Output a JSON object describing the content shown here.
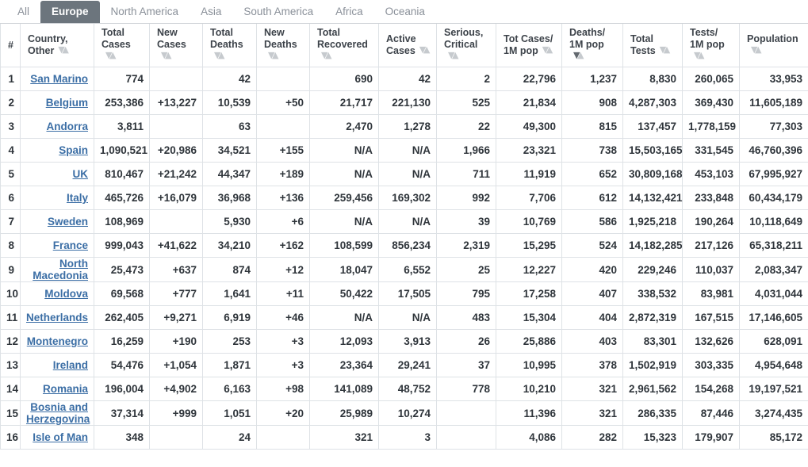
{
  "tabs": [
    {
      "label": "All",
      "active": false
    },
    {
      "label": "Europe",
      "active": true
    },
    {
      "label": "North America",
      "active": false
    },
    {
      "label": "Asia",
      "active": false
    },
    {
      "label": "South America",
      "active": false
    },
    {
      "label": "Africa",
      "active": false
    },
    {
      "label": "Oceania",
      "active": false
    }
  ],
  "colors": {
    "active_tab_bg": "#6c757d",
    "new_cases_highlight": "#fae5a0",
    "new_deaths_highlight": "#ff0000",
    "link": "#3b6ea5"
  },
  "table": {
    "columns": [
      {
        "key": "num",
        "line1": "#",
        "line2": "",
        "sortable": false,
        "sorted": false
      },
      {
        "key": "country",
        "line1": "Country,",
        "line2": "Other",
        "sortable": true,
        "sorted": false
      },
      {
        "key": "total_cases",
        "line1": "Total",
        "line2": "Cases",
        "sortable": true,
        "sorted": false
      },
      {
        "key": "new_cases",
        "line1": "New",
        "line2": "Cases",
        "sortable": true,
        "sorted": false
      },
      {
        "key": "total_deaths",
        "line1": "Total",
        "line2": "Deaths",
        "sortable": true,
        "sorted": false
      },
      {
        "key": "new_deaths",
        "line1": "New",
        "line2": "Deaths",
        "sortable": true,
        "sorted": false
      },
      {
        "key": "total_recovered",
        "line1": "Total",
        "line2": "Recovered",
        "sortable": true,
        "sorted": false
      },
      {
        "key": "active_cases",
        "line1": "Active",
        "line2": "Cases",
        "sortable": true,
        "sorted": false
      },
      {
        "key": "serious",
        "line1": "Serious,",
        "line2": "Critical",
        "sortable": true,
        "sorted": false
      },
      {
        "key": "cases_1m",
        "line1": "Tot Cases/",
        "line2": "1M pop",
        "sortable": true,
        "sorted": false
      },
      {
        "key": "deaths_1m",
        "line1": "Deaths/",
        "line2": "1M pop",
        "sortable": true,
        "sorted": true
      },
      {
        "key": "total_tests",
        "line1": "Total",
        "line2": "Tests",
        "sortable": true,
        "sorted": false
      },
      {
        "key": "tests_1m",
        "line1": "Tests/",
        "line2": "1M pop",
        "sortable": true,
        "sorted": false
      },
      {
        "key": "population",
        "line1": "Population",
        "line2": "",
        "sortable": true,
        "sorted": false
      }
    ],
    "rows": [
      {
        "num": "1",
        "country": "San Marino",
        "total_cases": "774",
        "new_cases": "",
        "total_deaths": "42",
        "new_deaths": "",
        "total_recovered": "690",
        "active_cases": "42",
        "serious": "2",
        "cases_1m": "22,796",
        "deaths_1m": "1,237",
        "total_tests": "8,830",
        "tests_1m": "260,065",
        "population": "33,953",
        "tall": false
      },
      {
        "num": "2",
        "country": "Belgium",
        "total_cases": "253,386",
        "new_cases": "+13,227",
        "total_deaths": "10,539",
        "new_deaths": "+50",
        "total_recovered": "21,717",
        "active_cases": "221,130",
        "serious": "525",
        "cases_1m": "21,834",
        "deaths_1m": "908",
        "total_tests": "4,287,303",
        "tests_1m": "369,430",
        "population": "11,605,189",
        "tall": false
      },
      {
        "num": "3",
        "country": "Andorra",
        "total_cases": "3,811",
        "new_cases": "",
        "total_deaths": "63",
        "new_deaths": "",
        "total_recovered": "2,470",
        "active_cases": "1,278",
        "serious": "22",
        "cases_1m": "49,300",
        "deaths_1m": "815",
        "total_tests": "137,457",
        "tests_1m": "1,778,159",
        "population": "77,303",
        "tall": false
      },
      {
        "num": "4",
        "country": "Spain",
        "total_cases": "1,090,521",
        "new_cases": "+20,986",
        "total_deaths": "34,521",
        "new_deaths": "+155",
        "total_recovered": "N/A",
        "active_cases": "N/A",
        "serious": "1,966",
        "cases_1m": "23,321",
        "deaths_1m": "738",
        "total_tests": "15,503,165",
        "tests_1m": "331,545",
        "population": "46,760,396",
        "tall": false
      },
      {
        "num": "5",
        "country": "UK",
        "total_cases": "810,467",
        "new_cases": "+21,242",
        "total_deaths": "44,347",
        "new_deaths": "+189",
        "total_recovered": "N/A",
        "active_cases": "N/A",
        "serious": "711",
        "cases_1m": "11,919",
        "deaths_1m": "652",
        "total_tests": "30,809,168",
        "tests_1m": "453,103",
        "population": "67,995,927",
        "tall": false
      },
      {
        "num": "6",
        "country": "Italy",
        "total_cases": "465,726",
        "new_cases": "+16,079",
        "total_deaths": "36,968",
        "new_deaths": "+136",
        "total_recovered": "259,456",
        "active_cases": "169,302",
        "serious": "992",
        "cases_1m": "7,706",
        "deaths_1m": "612",
        "total_tests": "14,132,421",
        "tests_1m": "233,848",
        "population": "60,434,179",
        "tall": false
      },
      {
        "num": "7",
        "country": "Sweden",
        "total_cases": "108,969",
        "new_cases": "",
        "total_deaths": "5,930",
        "new_deaths": "+6",
        "total_recovered": "N/A",
        "active_cases": "N/A",
        "serious": "39",
        "cases_1m": "10,769",
        "deaths_1m": "586",
        "total_tests": "1,925,218",
        "tests_1m": "190,264",
        "population": "10,118,649",
        "tall": false
      },
      {
        "num": "8",
        "country": "France",
        "total_cases": "999,043",
        "new_cases": "+41,622",
        "total_deaths": "34,210",
        "new_deaths": "+162",
        "total_recovered": "108,599",
        "active_cases": "856,234",
        "serious": "2,319",
        "cases_1m": "15,295",
        "deaths_1m": "524",
        "total_tests": "14,182,285",
        "tests_1m": "217,126",
        "population": "65,318,211",
        "tall": false
      },
      {
        "num": "9",
        "country": "North Macedonia",
        "total_cases": "25,473",
        "new_cases": "+637",
        "total_deaths": "874",
        "new_deaths": "+12",
        "total_recovered": "18,047",
        "active_cases": "6,552",
        "serious": "25",
        "cases_1m": "12,227",
        "deaths_1m": "420",
        "total_tests": "229,246",
        "tests_1m": "110,037",
        "population": "2,083,347",
        "tall": true
      },
      {
        "num": "10",
        "country": "Moldova",
        "total_cases": "69,568",
        "new_cases": "+777",
        "total_deaths": "1,641",
        "new_deaths": "+11",
        "total_recovered": "50,422",
        "active_cases": "17,505",
        "serious": "795",
        "cases_1m": "17,258",
        "deaths_1m": "407",
        "total_tests": "338,532",
        "tests_1m": "83,981",
        "population": "4,031,044",
        "tall": false
      },
      {
        "num": "11",
        "country": "Netherlands",
        "total_cases": "262,405",
        "new_cases": "+9,271",
        "total_deaths": "6,919",
        "new_deaths": "+46",
        "total_recovered": "N/A",
        "active_cases": "N/A",
        "serious": "483",
        "cases_1m": "15,304",
        "deaths_1m": "404",
        "total_tests": "2,872,319",
        "tests_1m": "167,515",
        "population": "17,146,605",
        "tall": false
      },
      {
        "num": "12",
        "country": "Montenegro",
        "total_cases": "16,259",
        "new_cases": "+190",
        "total_deaths": "253",
        "new_deaths": "+3",
        "total_recovered": "12,093",
        "active_cases": "3,913",
        "serious": "26",
        "cases_1m": "25,886",
        "deaths_1m": "403",
        "total_tests": "83,301",
        "tests_1m": "132,626",
        "population": "628,091",
        "tall": false
      },
      {
        "num": "13",
        "country": "Ireland",
        "total_cases": "54,476",
        "new_cases": "+1,054",
        "total_deaths": "1,871",
        "new_deaths": "+3",
        "total_recovered": "23,364",
        "active_cases": "29,241",
        "serious": "37",
        "cases_1m": "10,995",
        "deaths_1m": "378",
        "total_tests": "1,502,919",
        "tests_1m": "303,335",
        "population": "4,954,648",
        "tall": false
      },
      {
        "num": "14",
        "country": "Romania",
        "total_cases": "196,004",
        "new_cases": "+4,902",
        "total_deaths": "6,163",
        "new_deaths": "+98",
        "total_recovered": "141,089",
        "active_cases": "48,752",
        "serious": "778",
        "cases_1m": "10,210",
        "deaths_1m": "321",
        "total_tests": "2,961,562",
        "tests_1m": "154,268",
        "population": "19,197,521",
        "tall": false
      },
      {
        "num": "15",
        "country": "Bosnia and Herzegovina",
        "total_cases": "37,314",
        "new_cases": "+999",
        "total_deaths": "1,051",
        "new_deaths": "+20",
        "total_recovered": "25,989",
        "active_cases": "10,274",
        "serious": "",
        "cases_1m": "11,396",
        "deaths_1m": "321",
        "total_tests": "286,335",
        "tests_1m": "87,446",
        "population": "3,274,435",
        "tall": true
      },
      {
        "num": "16",
        "country": "Isle of Man",
        "total_cases": "348",
        "new_cases": "",
        "total_deaths": "24",
        "new_deaths": "",
        "total_recovered": "321",
        "active_cases": "3",
        "serious": "",
        "cases_1m": "4,086",
        "deaths_1m": "282",
        "total_tests": "15,323",
        "tests_1m": "179,907",
        "population": "85,172",
        "tall": false
      }
    ]
  }
}
